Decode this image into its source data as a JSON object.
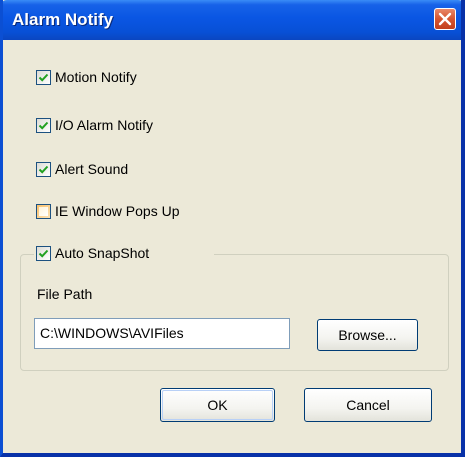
{
  "dialog": {
    "title": "Alarm Notify"
  },
  "options": [
    {
      "label": "Motion Notify",
      "checked": true
    },
    {
      "label": "I/O Alarm Notify",
      "checked": true
    },
    {
      "label": "Alert Sound",
      "checked": true
    },
    {
      "label": "IE Window Pops Up",
      "checked": false
    }
  ],
  "snapshot": {
    "label": "Auto SnapShot",
    "checked": true,
    "file_path_label": "File Path",
    "file_path_value": "C:\\WINDOWS\\AVIFiles",
    "browse_label": "Browse..."
  },
  "buttons": {
    "ok_label": "OK",
    "cancel_label": "Cancel"
  },
  "colors": {
    "titlebar": "#0a56e3",
    "dialog_bg": "#ece9d8",
    "check_mark": "#21a121"
  }
}
